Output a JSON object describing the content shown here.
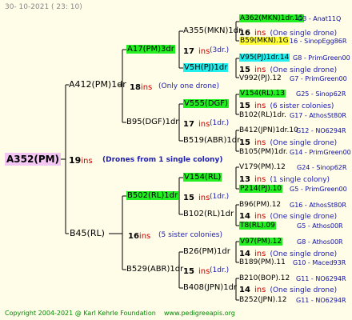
{
  "header": {
    "date": "30-  10-2021  (  23:  10)"
  },
  "root": {
    "name": "A352(PM)",
    "ins": "19",
    "ins_label": "ins",
    "note": "(Drones from 1 single colony)"
  },
  "g1": [
    {
      "name": "A412(PM)1dr",
      "ins": "18",
      "ins_label": "ins",
      "note": "(Only one drone)"
    },
    {
      "name": "B45(RL)",
      "ins": "16",
      "ins_label": "ins",
      "note": "(5 sister colonies)"
    }
  ],
  "g2": [
    {
      "name": "A17(PM)3dr",
      "ins": "17",
      "ins_label": "ins",
      "note": "(3dr.)"
    },
    {
      "name": "B95(DGF)1dr",
      "ins": "17",
      "ins_label": "ins",
      "note": "(1dr.)"
    },
    {
      "name": "B502(RL)1dr",
      "ins": "15",
      "ins_label": "ins",
      "note": "(1dr.)"
    },
    {
      "name": "B529(ABR)1dr",
      "ins": "15",
      "ins_label": "ins",
      "note": "(1dr.)"
    }
  ],
  "g3": [
    {
      "name": "A355(MKN)1dr",
      "ins": "16",
      "ins_label": "ins",
      "note": "(One single drone)"
    },
    {
      "name": "V5H(PJ)1dr",
      "ins": "15",
      "ins_label": "ins",
      "note": "(One single drone)"
    },
    {
      "name": "V555(DGF)",
      "ins": "15",
      "ins_label": "ins",
      "note": "(6 sister colonies)"
    },
    {
      "name": "B519(ABR)1dr",
      "ins": "15",
      "ins_label": "ins",
      "note": "(One single drone)"
    },
    {
      "name": "V154(RL)",
      "ins": "13",
      "ins_label": "ins",
      "note": "(1 single colony)"
    },
    {
      "name": "B102(RL)1dr",
      "ins": "14",
      "ins_label": "ins",
      "note": "(One single drone)"
    },
    {
      "name": "B26(PM)1dr",
      "ins": "14",
      "ins_label": "ins",
      "note": "(One single drone)"
    },
    {
      "name": "B408(JPN)1dr",
      "ins": "14",
      "ins_label": "ins",
      "note": "(One single drone)"
    }
  ],
  "g4": [
    {
      "name": "A362(MKN)1dr.15",
      "code": "G3 - Anat11Q"
    },
    {
      "name": "B59(MKN).1G",
      "code": "16 - SinopEgg86R"
    },
    {
      "name": "V95(PJ)1dr.14",
      "code": "G8 - PrimGreen00"
    },
    {
      "name": "V992(PJ).12",
      "code": "G7 - PrimGreen00"
    },
    {
      "name": "V154(RL).13",
      "code": "G25 - Sinop62R"
    },
    {
      "name": "B102(RL)1dr.",
      "code": "G17 - AthosSt80R"
    },
    {
      "name": "B412(JPN)1dr.10",
      "code": "G12 - NO6294R"
    },
    {
      "name": "B105(PM)1dr.",
      "code": "G14 - PrimGreen00"
    },
    {
      "name": "V179(PM).12",
      "code": "G24 - Sinop62R"
    },
    {
      "name": "P214(PJ).10",
      "code": "G5 - PrimGreen00"
    },
    {
      "name": "B96(PM).12",
      "code": "G16 - AthosSt80R"
    },
    {
      "name": "T8(RL).09",
      "code": "G5 - Athos00R"
    },
    {
      "name": "V97(PM).12",
      "code": "G8 - Athos00R"
    },
    {
      "name": "B189(PM).11",
      "code": "G10 - Maced93R"
    },
    {
      "name": "B210(BOP).12",
      "code": "G11 - NO6294R"
    },
    {
      "name": "B252(JPN).12",
      "code": "G11 - NO6294R"
    }
  ],
  "footer": {
    "copyright": "Copyright 2004-2021 @ Karl Kehrle Foundation",
    "site": "www.pedigreeapis.org"
  }
}
